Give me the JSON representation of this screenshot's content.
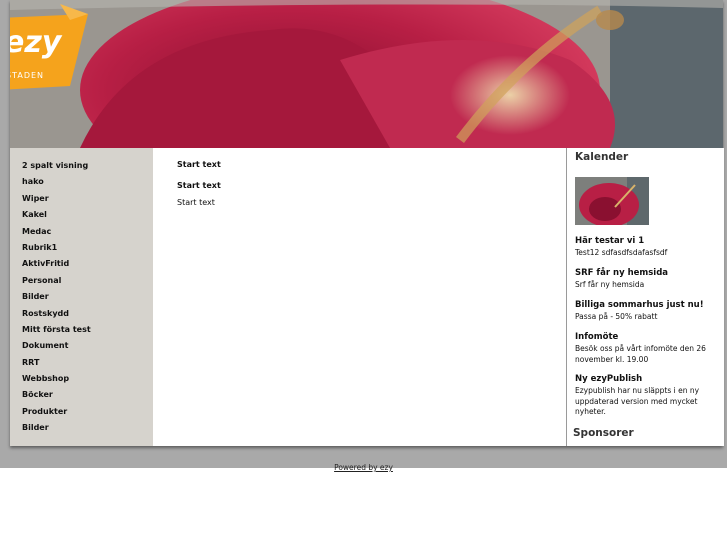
{
  "header": {
    "logo_text": "ezy",
    "logo_subtext": "STADEN"
  },
  "nav": {
    "items": [
      "2 spalt visning",
      "hako",
      "Wiper",
      "Kakel",
      "Medac",
      "Rubrik1",
      "AktivFritid",
      "Personal",
      "Bilder",
      "Rostskydd",
      "Mitt första test",
      "Dokument",
      "RRT",
      "Webbshop",
      "Böcker",
      "Produkter",
      "Bilder"
    ]
  },
  "main": {
    "title": "Start text",
    "heading": "Start text",
    "body": "Start text"
  },
  "sidebar": {
    "calendar_title": "Kalender",
    "news": [
      {
        "title": "Här testar vi 1",
        "text": "Test12 sdfasdfsdafasfsdf"
      },
      {
        "title": "SRF får ny hemsida",
        "text": "Srf får ny hemsida"
      },
      {
        "title": "Billiga sommarhus just nu!",
        "text": "Passa på - 50% rabatt"
      },
      {
        "title": "Infomöte",
        "text": "Besök oss på vårt infomöte den 26 november kl. 19.00"
      },
      {
        "title": "Ny ezyPublish",
        "text": "Ezypublish har nu släppts i en ny uppdaterad version med mycket nyheter."
      }
    ],
    "sponsor_title": "Sponsorer"
  },
  "footer": {
    "powered_by": "Powered by ezy"
  },
  "colors": {
    "logo_orange": "#f5a31c",
    "nav_bg": "#d6d3cd",
    "outer_band": "#a9a9a9"
  }
}
